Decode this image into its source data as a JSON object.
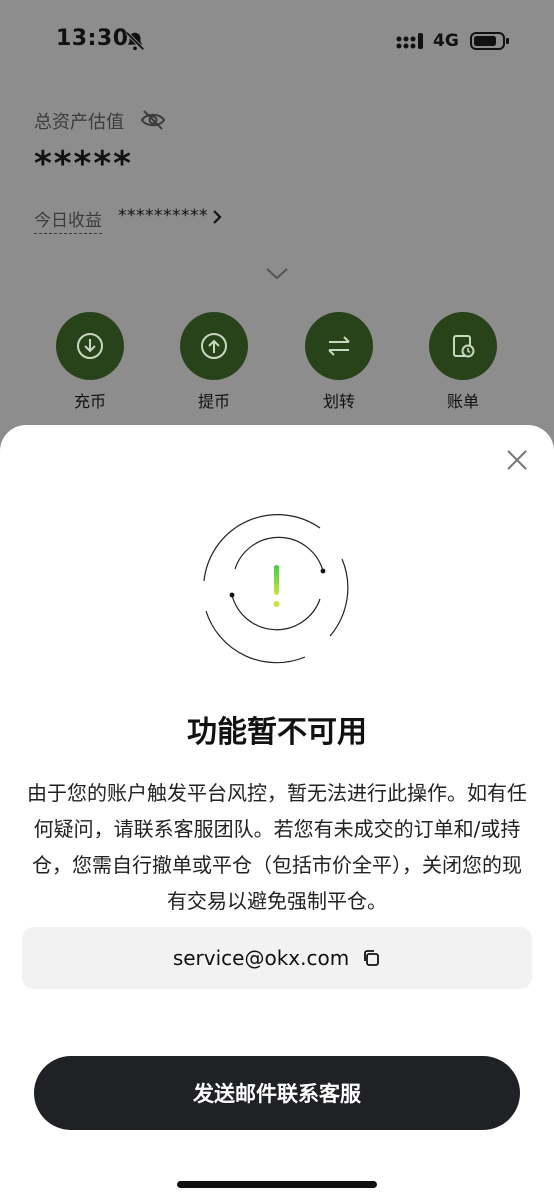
{
  "status_bar": {
    "time": "13:30",
    "network": "4G",
    "icons": [
      "bell-slash-icon",
      "signal-icon",
      "battery-icon"
    ]
  },
  "account": {
    "total_assets_label": "总资产估值",
    "total_assets_value": "*****",
    "today_pnl_label": "今日收益",
    "today_pnl_value": "**********"
  },
  "actions": [
    {
      "label": "充币",
      "icon": "deposit-icon"
    },
    {
      "label": "提币",
      "icon": "withdraw-icon"
    },
    {
      "label": "划转",
      "icon": "transfer-icon"
    },
    {
      "label": "账单",
      "icon": "bill-icon"
    }
  ],
  "modal": {
    "title": "功能暂不可用",
    "message": "由于您的账户触发平台风控，暂无法进行此操作。如有任何疑问，请联系客服团队。若您有未成交的订单和/或持仓，您需自行撤单或平仓（包括市价全平），关闭您的现有交易以避免强制平仓。",
    "email": "service@okx.com",
    "button_label": "发送邮件联系客服"
  },
  "colors": {
    "action_circle": "#28421a",
    "warning_green": "#3ecf3e",
    "button_dark": "#1f2125",
    "overlay": "#8d8d8d"
  }
}
